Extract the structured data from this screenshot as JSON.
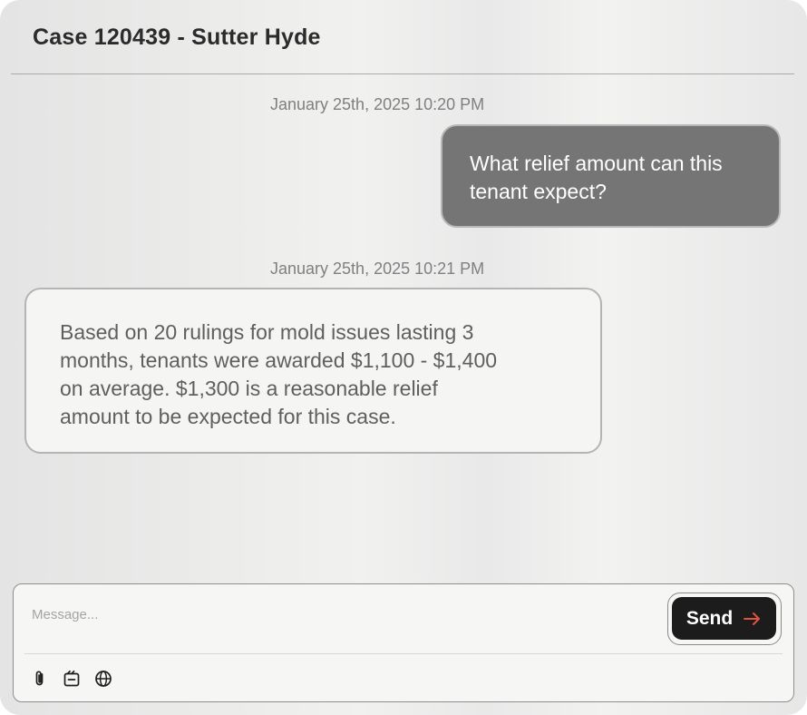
{
  "header": {
    "title": "Case 120439 - Sutter Hyde"
  },
  "messages": [
    {
      "timestamp": "January 25th, 2025 10:20 PM",
      "sender": "user",
      "lines": [
        "What relief amount can this",
        "tenant expect?"
      ]
    },
    {
      "timestamp": "January 25th, 2025 10:21 PM",
      "sender": "assistant",
      "lines": [
        "Based on 20 rulings for mold issues lasting 3",
        "months, tenants were awarded $1,100 - $1,400",
        "on average. $1,300 is a reasonable relief",
        "amount to be expected for this case."
      ]
    }
  ],
  "composer": {
    "placeholder": "Message...",
    "value": "",
    "send_label": "Send",
    "tools": [
      {
        "icon": "paperclip-icon"
      },
      {
        "icon": "clipboard-icon"
      },
      {
        "icon": "globe-icon"
      }
    ]
  },
  "colors": {
    "user_bubble": "#757575",
    "assistant_bubble": "#f5f5f4",
    "send_button": "#1c1c1c",
    "send_arrow": "#e0533f",
    "timestamp_text": "#808080"
  }
}
